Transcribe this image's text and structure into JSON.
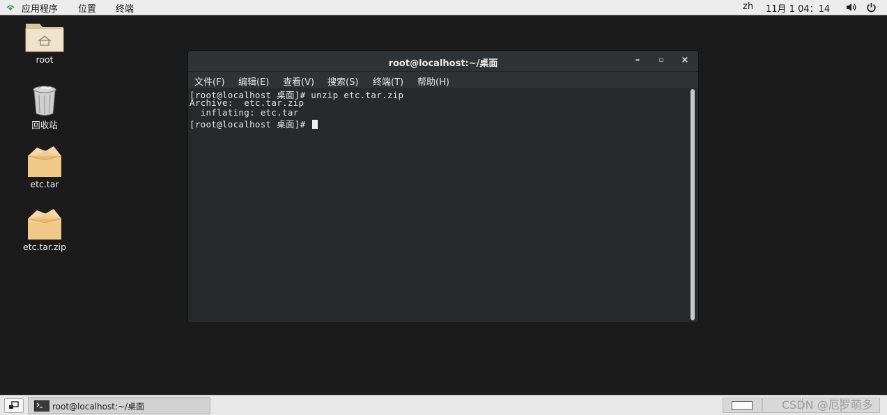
{
  "topbar": {
    "apps": "应用程序",
    "places": "位置",
    "terminal": "终端",
    "lang": "zh",
    "datetime": "11月 1 04：14"
  },
  "desktop": {
    "icons": [
      {
        "label": "root",
        "icon": "home-folder-icon"
      },
      {
        "label": "回收站",
        "icon": "trash-icon"
      },
      {
        "label": "etc.tar",
        "icon": "package-icon"
      },
      {
        "label": "etc.tar.zip",
        "icon": "package-icon"
      }
    ]
  },
  "terminal": {
    "title": "root@localhost:~/桌面",
    "controls": {
      "minimize": "–",
      "maximize": "▫",
      "close": "×"
    },
    "menu": [
      "文件(F)",
      "编辑(E)",
      "查看(V)",
      "搜索(S)",
      "终端(T)",
      "帮助(H)"
    ],
    "lines": [
      "[root@localhost 桌面]# unzip etc.tar.zip",
      "Archive:  etc.tar.zip",
      "  inflating: etc.tar",
      "[root@localhost 桌面]# "
    ]
  },
  "taskbar": {
    "window_label": "root@localhost:~/桌面"
  },
  "watermark": "CSDN @厄罗萌多",
  "colors": {
    "desktop_bg": "#1b1b1b",
    "terminal_bg": "#262a2b",
    "terminal_text": "#e6e6e6",
    "folder": "#e8c88e"
  }
}
